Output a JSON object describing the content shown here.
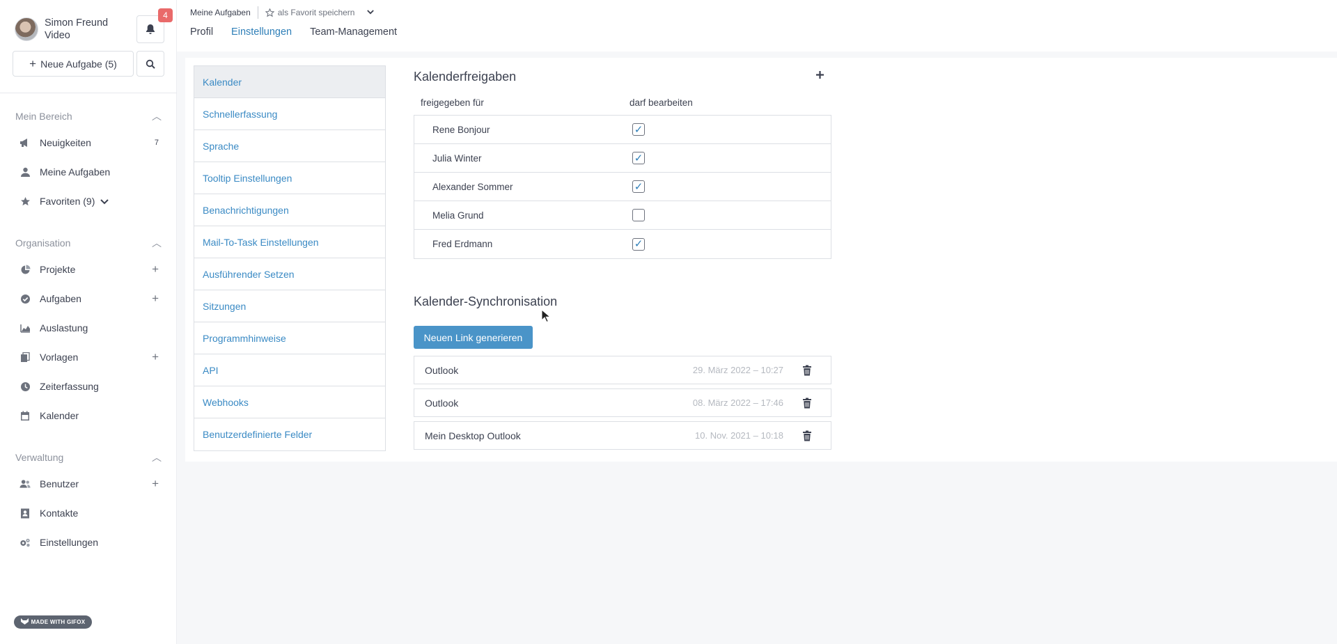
{
  "user": {
    "name": "Simon Freund",
    "role": "Video"
  },
  "notifications": {
    "count": "4"
  },
  "sidebar": {
    "new_task": "Neue Aufgabe (5)",
    "sections": [
      {
        "title": "Mein Bereich"
      },
      {
        "title": "Organisation"
      },
      {
        "title": "Verwaltung"
      }
    ],
    "mein_bereich": [
      {
        "label": "Neuigkeiten",
        "count": "7"
      },
      {
        "label": "Meine Aufgaben"
      },
      {
        "label": "Favoriten (9)"
      }
    ],
    "organisation": [
      {
        "label": "Projekte"
      },
      {
        "label": "Aufgaben"
      },
      {
        "label": "Auslastung"
      },
      {
        "label": "Vorlagen"
      },
      {
        "label": "Zeiterfassung"
      },
      {
        "label": "Kalender"
      }
    ],
    "verwaltung": [
      {
        "label": "Benutzer"
      },
      {
        "label": "Kontakte"
      },
      {
        "label": "Einstellungen"
      }
    ],
    "gifox": "MADE WITH GIFOX"
  },
  "header": {
    "breadcrumb": "Meine Aufgaben",
    "favorite": "als Favorit speichern",
    "tabs": [
      {
        "label": "Profil"
      },
      {
        "label": "Einstellungen"
      },
      {
        "label": "Team-Management"
      }
    ]
  },
  "settings_menu": [
    "Kalender",
    "Schnellerfassung",
    "Sprache",
    "Tooltip Einstellungen",
    "Benachrichtigungen",
    "Mail-To-Task Einstellungen",
    "Ausführender Setzen",
    "Sitzungen",
    "Programmhinweise",
    "API",
    "Webhooks",
    "Benutzerdefinierte Felder"
  ],
  "calendar_shares": {
    "title": "Kalenderfreigaben",
    "col_shared_for": "freigegeben für",
    "col_may_edit": "darf bearbeiten",
    "rows": [
      {
        "name": "Rene Bonjour",
        "can_edit": true
      },
      {
        "name": "Julia Winter",
        "can_edit": true
      },
      {
        "name": "Alexander Sommer",
        "can_edit": true
      },
      {
        "name": "Melia Grund",
        "can_edit": false
      },
      {
        "name": "Fred Erdmann",
        "can_edit": true
      }
    ]
  },
  "calendar_sync": {
    "title": "Kalender-Synchronisation",
    "generate_button": "Neuen Link generieren",
    "links": [
      {
        "name": "Outlook",
        "date": "29. März 2022 – 10:27"
      },
      {
        "name": "Outlook",
        "date": "08. März 2022 – 17:46"
      },
      {
        "name": "Mein Desktop Outlook",
        "date": "10. Nov. 2021 – 10:18"
      }
    ]
  },
  "colors": {
    "accent": "#2f7fb8",
    "link": "#3a8ac4",
    "button": "#4a94c8",
    "badge": "#e96a6a"
  }
}
